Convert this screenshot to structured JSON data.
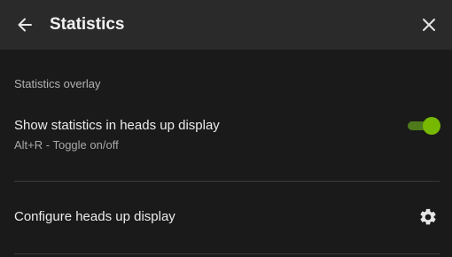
{
  "header": {
    "title": "Statistics",
    "back_icon": "arrow-left-icon",
    "close_icon": "close-icon"
  },
  "section": {
    "label": "Statistics overlay"
  },
  "hud_toggle_row": {
    "title": "Show statistics in heads up display",
    "subtitle": "Alt+R - Toggle on/off",
    "enabled": true,
    "accent_color": "#76b900"
  },
  "configure_row": {
    "title": "Configure heads up display",
    "icon": "gear-icon"
  }
}
